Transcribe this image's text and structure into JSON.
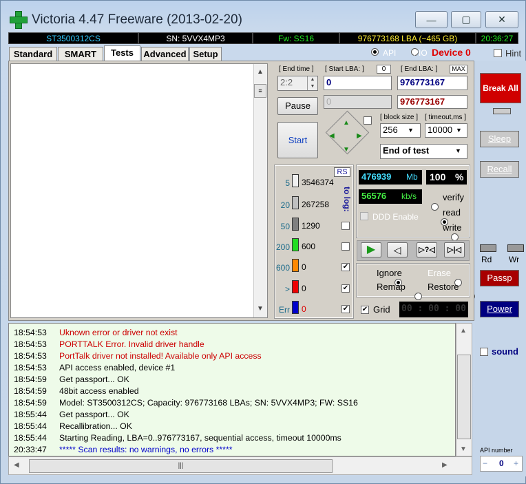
{
  "window": {
    "title": "Victoria 4.47  Freeware (2013-02-20)",
    "min": "—",
    "max": "▢",
    "close": "✕"
  },
  "infobar": {
    "model": "ST3500312CS",
    "serial": "SN: 5VVX4MP3",
    "firmware": "Fw: SS16",
    "capacity": "976773168 LBA (~465 GB)",
    "clock": "20:36:27"
  },
  "tabs": [
    "Standard",
    "SMART",
    "Tests",
    "Advanced",
    "Setup"
  ],
  "mode": {
    "api": "API",
    "pio": "PIO",
    "device": "Device 0",
    "hint": "Hint"
  },
  "test": {
    "end_time_label": "[ End time ]",
    "end_time": "2:2",
    "start_lba_label": "[ Start LBA: ]",
    "start_lba_zero": "0",
    "start_lba": "0",
    "end_lba_label": "[ End LBA: ]",
    "end_lba_max": "MAX",
    "end_lba": "976773167",
    "cur_lba": "0",
    "cur_end": "976773167",
    "pause": "Pause",
    "start": "Start",
    "block_size_label": "[ block size ]",
    "block_size": "256",
    "timeout_label": "[ timeout,ms ]",
    "timeout": "10000",
    "end_mode": "End of test"
  },
  "stats": {
    "rs": "RS",
    "to_log": "to log:",
    "rows": [
      {
        "ms": "5",
        "count": "3546374",
        "color": "#f0f0f0",
        "checked": false
      },
      {
        "ms": "20",
        "count": "267258",
        "color": "#c0c0c0",
        "checked": false
      },
      {
        "ms": "50",
        "count": "1290",
        "color": "#808080",
        "checked": false
      },
      {
        "ms": "200",
        "count": "600",
        "color": "#22dd22",
        "checked": false
      },
      {
        "ms": "600",
        "count": "0",
        "color": "#ff8800",
        "checked": true
      },
      {
        "ms": ">",
        "count": "0",
        "color": "#ee0000",
        "checked": true
      },
      {
        "ms": "Err",
        "count": "0",
        "color": "#0000cc",
        "checked": true
      }
    ]
  },
  "progress": {
    "mb": "476939",
    "mb_unit": "Mb",
    "percent": "100",
    "percent_unit": "%",
    "speed": "56576",
    "speed_unit": "kb/s",
    "ddd": "DDD Enable",
    "verify": "verify",
    "read": "read",
    "write": "write"
  },
  "actions": {
    "ignore": "Ignore",
    "erase": "Erase",
    "remap": "Remap",
    "restore": "Restore",
    "grid": "Grid",
    "timer": "00 : 00 : 00"
  },
  "side": {
    "break_all": "Break All",
    "sleep": "Sleep",
    "recall": "Recall",
    "rd": "Rd",
    "wr": "Wr",
    "passp": "Passp",
    "power": "Power",
    "sound": "sound",
    "api_number_label": "API number",
    "api_number": "0"
  },
  "log": [
    {
      "time": "18:54:53",
      "msg": "Uknown error or driver not exist",
      "color": "#cc0000"
    },
    {
      "time": "18:54:53",
      "msg": "PORTTALK Error. Invalid driver handle",
      "color": "#cc0000"
    },
    {
      "time": "18:54:53",
      "msg": "PortTalk driver not installed! Available only API access",
      "color": "#cc0000"
    },
    {
      "time": "18:54:53",
      "msg": "API access enabled, device #1",
      "color": "#000000"
    },
    {
      "time": "18:54:59",
      "msg": "Get passport... OK",
      "color": "#000000"
    },
    {
      "time": "18:54:59",
      "msg": "48bit access enabled",
      "color": "#000000"
    },
    {
      "time": "18:54:59",
      "msg": "Model: ST3500312CS; Capacity: 976773168 LBAs; SN: 5VVX4MP3; FW: SS16",
      "color": "#000000"
    },
    {
      "time": "18:55:44",
      "msg": "Get passport... OK",
      "color": "#000000"
    },
    {
      "time": "18:55:44",
      "msg": "Recallibration... OK",
      "color": "#000000"
    },
    {
      "time": "18:55:44",
      "msg": "Starting Reading, LBA=0..976773167, sequential access, timeout 10000ms",
      "color": "#000000"
    },
    {
      "time": "20:33:47",
      "msg": "***** Scan results: no warnings, no errors *****",
      "color": "#0000cc"
    }
  ]
}
